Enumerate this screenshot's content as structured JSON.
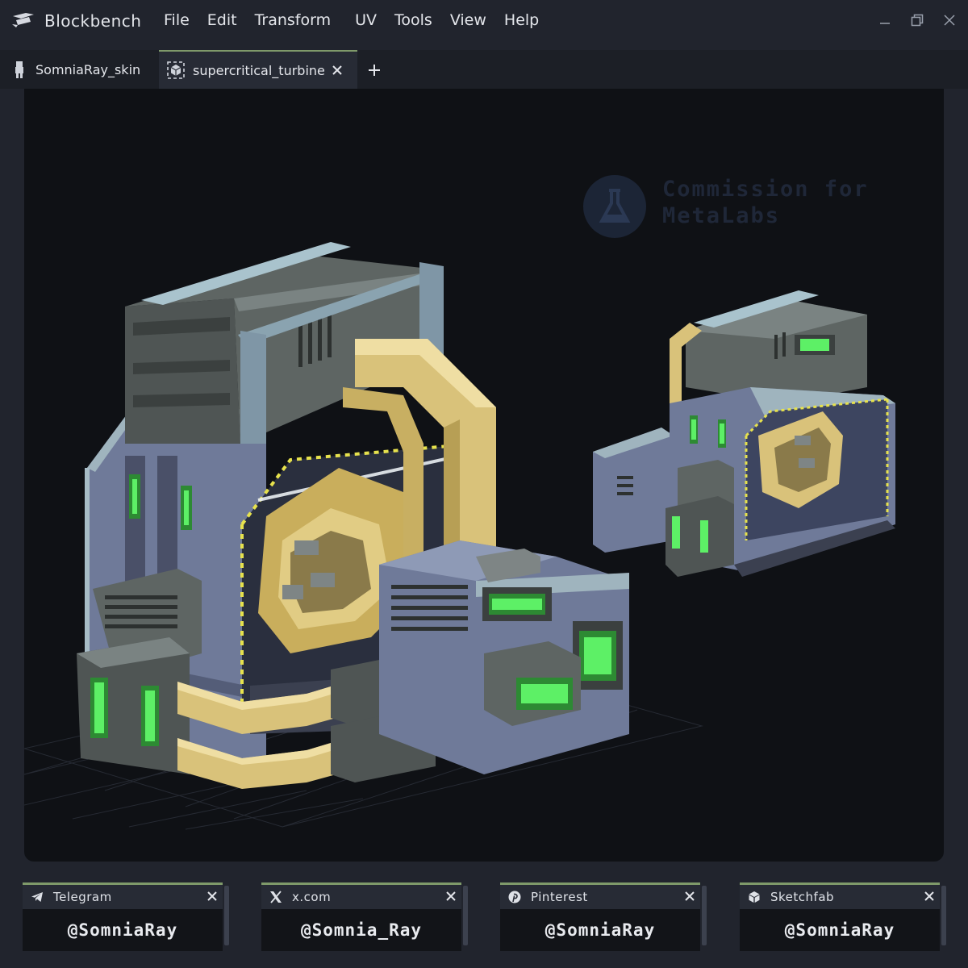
{
  "app": {
    "name": "Blockbench"
  },
  "menu": [
    "File",
    "Edit",
    "Transform",
    "UV",
    "Tools",
    "View",
    "Help"
  ],
  "tabs": [
    {
      "label": "SomniaRay_skin",
      "icon": "person-icon",
      "active": false
    },
    {
      "label": "supercritical_turbine",
      "icon": "cube-icon",
      "active": true
    }
  ],
  "viewport": {
    "watermark": {
      "line1": "Commission for",
      "line2": "MetaLabs"
    }
  },
  "panels": [
    {
      "name": "Telegram",
      "icon": "telegram-icon",
      "handle": "@SomniaRay"
    },
    {
      "name": "x.com",
      "icon": "x-icon",
      "handle": "@Somnia_Ray"
    },
    {
      "name": "Pinterest",
      "icon": "pinterest-icon",
      "handle": "@SomniaRay"
    },
    {
      "name": "Sketchfab",
      "icon": "sketchfab-icon",
      "handle": "@SomniaRay"
    }
  ],
  "colors": {
    "accent": "#7f9a6a",
    "background": "#21242d",
    "viewport": "#0f1115",
    "brass": "#d9c27a",
    "glow": "#3fd24a",
    "steel": "#6f7a99"
  }
}
